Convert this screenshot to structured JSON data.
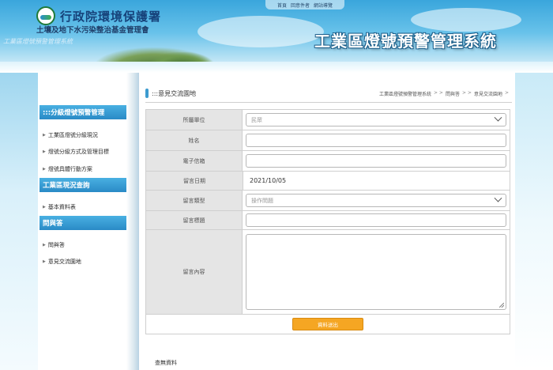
{
  "header": {
    "org_title": "行政院環境保護署",
    "org_subtitle": "土壤及地下水污染整治基金管理會",
    "brand_watermark": "工業區燈號預警管理系統",
    "system_title": "工業區燈號預警管理系統",
    "top_nav": [
      "首頁",
      "回意件者",
      "網站導覽"
    ]
  },
  "sidebar": {
    "sections": [
      {
        "heading": ":::分級燈號預警管理",
        "items": [
          "工業區燈號分級現況",
          "燈號分級方式及管理目標",
          "燈號具體行動方案"
        ]
      },
      {
        "heading": "工業區現況查詢",
        "items": [
          "基本資料表"
        ]
      },
      {
        "heading": "問與答",
        "items": [
          "問與答",
          "意見交流園地"
        ]
      }
    ]
  },
  "main": {
    "page_title": ":::意見交流園地",
    "breadcrumb": [
      "工業區燈號預警管理系統",
      "問與答",
      "意見交流園地"
    ],
    "form": {
      "unit": {
        "label": "所屬單位",
        "value": "民眾"
      },
      "name": {
        "label": "姓名",
        "value": ""
      },
      "email": {
        "label": "電子信箱",
        "value": ""
      },
      "date": {
        "label": "留言日期",
        "value": "2021/10/05"
      },
      "type": {
        "label": "留言類型",
        "value": "操作問題"
      },
      "subject": {
        "label": "留言標題",
        "value": ""
      },
      "content": {
        "label": "留言內容",
        "value": ""
      },
      "submit_label": "資料送出"
    },
    "no_data": "查無資料"
  },
  "colors": {
    "accent_blue": "#2a8ac6",
    "submit_orange": "#f5a623",
    "label_bg": "#e5e5e5"
  }
}
